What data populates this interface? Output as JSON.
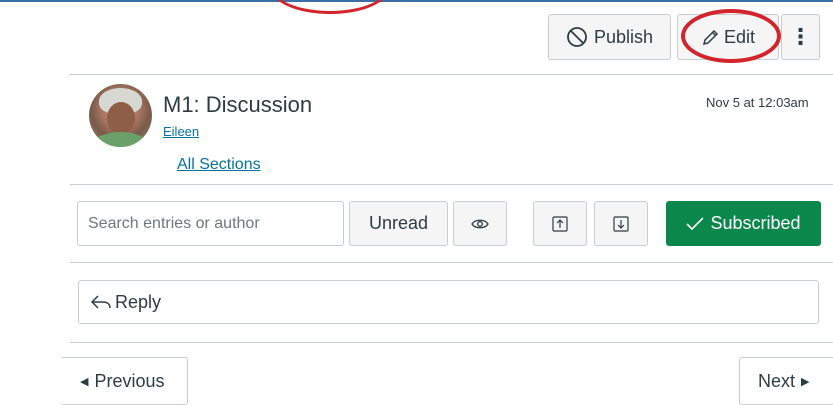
{
  "toolbar": {
    "publish_label": "Publish",
    "edit_label": "Edit",
    "more_label": "⋮"
  },
  "topic": {
    "title": "M1: Discussion",
    "author": "Eileen",
    "sections_link": "All Sections",
    "date": "Nov 5 at 12:03am"
  },
  "filters": {
    "search_placeholder": "Search entries or author",
    "unread_label": "Unread",
    "subscribed_label": "Subscribed"
  },
  "reply": {
    "label": "Reply"
  },
  "pager": {
    "previous_label": "Previous",
    "next_label": "Next"
  },
  "colors": {
    "link": "#0770a3",
    "success": "#0b874b",
    "annotation": "#d3232b",
    "border": "#c7cdd1"
  },
  "icons": [
    "no-entry-icon",
    "pencil-icon",
    "eye-icon",
    "expand-icon",
    "collapse-icon",
    "checkmark-icon",
    "reply-arrow-icon",
    "caret-left-icon",
    "caret-right-icon"
  ]
}
